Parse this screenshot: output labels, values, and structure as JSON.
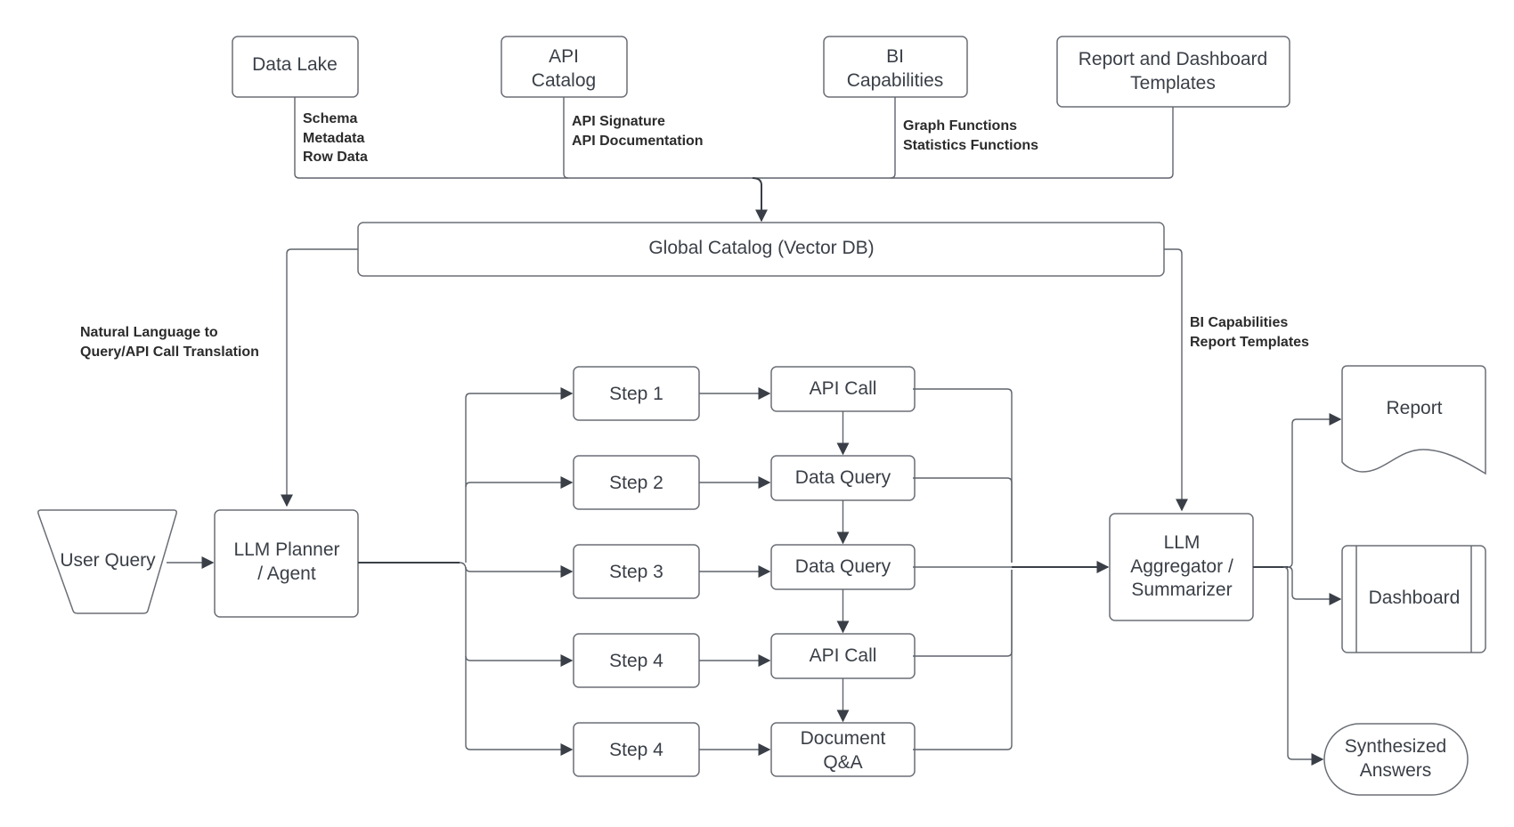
{
  "diagram": {
    "sources": [
      {
        "id": "data-lake",
        "lines": [
          "Data Lake"
        ],
        "annotation": [
          "Schema",
          "Metadata",
          "Row Data"
        ]
      },
      {
        "id": "api-catalog",
        "lines": [
          "API",
          "Catalog"
        ],
        "annotation": [
          "API Signature",
          "API Documentation"
        ]
      },
      {
        "id": "bi-capabilities",
        "lines": [
          "BI",
          "Capabilities"
        ],
        "annotation": [
          "Graph Functions",
          "Statistics Functions"
        ]
      },
      {
        "id": "report-templates",
        "lines": [
          "Report and Dashboard",
          "Templates"
        ],
        "annotation": []
      }
    ],
    "global_catalog": {
      "label": "Global Catalog (Vector DB)"
    },
    "left_annotation": [
      "Natural Language to",
      "Query/API Call Translation"
    ],
    "right_annotation": [
      "BI Capabilities",
      "Report Templates"
    ],
    "user_query": {
      "label": "User Query"
    },
    "planner": {
      "lines": [
        "LLM Planner",
        "/ Agent"
      ]
    },
    "steps": [
      {
        "step": "Step 1",
        "action": [
          "API Call"
        ]
      },
      {
        "step": "Step 2",
        "action": [
          "Data Query"
        ]
      },
      {
        "step": "Step 3",
        "action": [
          "Data Query"
        ]
      },
      {
        "step": "Step 4",
        "action": [
          "API Call"
        ]
      },
      {
        "step": "Step 4",
        "action": [
          "Document",
          "Q&A"
        ]
      }
    ],
    "aggregator": {
      "lines": [
        "LLM",
        "Aggregator /",
        "Summarizer"
      ]
    },
    "outputs": {
      "report": "Report",
      "dashboard": "Dashboard",
      "synthesized": [
        "Synthesized",
        "Answers"
      ]
    }
  }
}
